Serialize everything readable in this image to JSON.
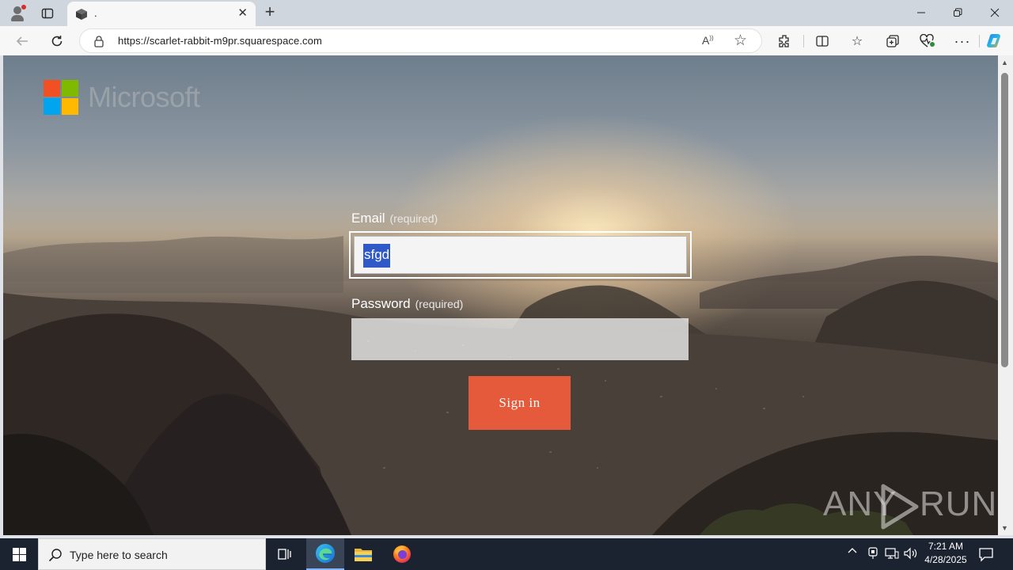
{
  "browser": {
    "tab": {
      "title": "."
    },
    "url": "https://scarlet-rabbit-m9pr.squarespace.com"
  },
  "page": {
    "brand": "Microsoft",
    "email": {
      "label": "Email",
      "required": "(required)",
      "value": "sfgd"
    },
    "password": {
      "label": "Password",
      "required": "(required)",
      "value": ""
    },
    "sign_in_label": "Sign in",
    "logo_colors": [
      "#f25022",
      "#7fba00",
      "#00a4ef",
      "#ffb900"
    ],
    "accent_color": "#e65a3c"
  },
  "watermark": {
    "left": "ANY",
    "right": "RUN"
  },
  "taskbar": {
    "search_placeholder": "Type here to search",
    "time": "7:21 AM",
    "date": "4/28/2025"
  }
}
